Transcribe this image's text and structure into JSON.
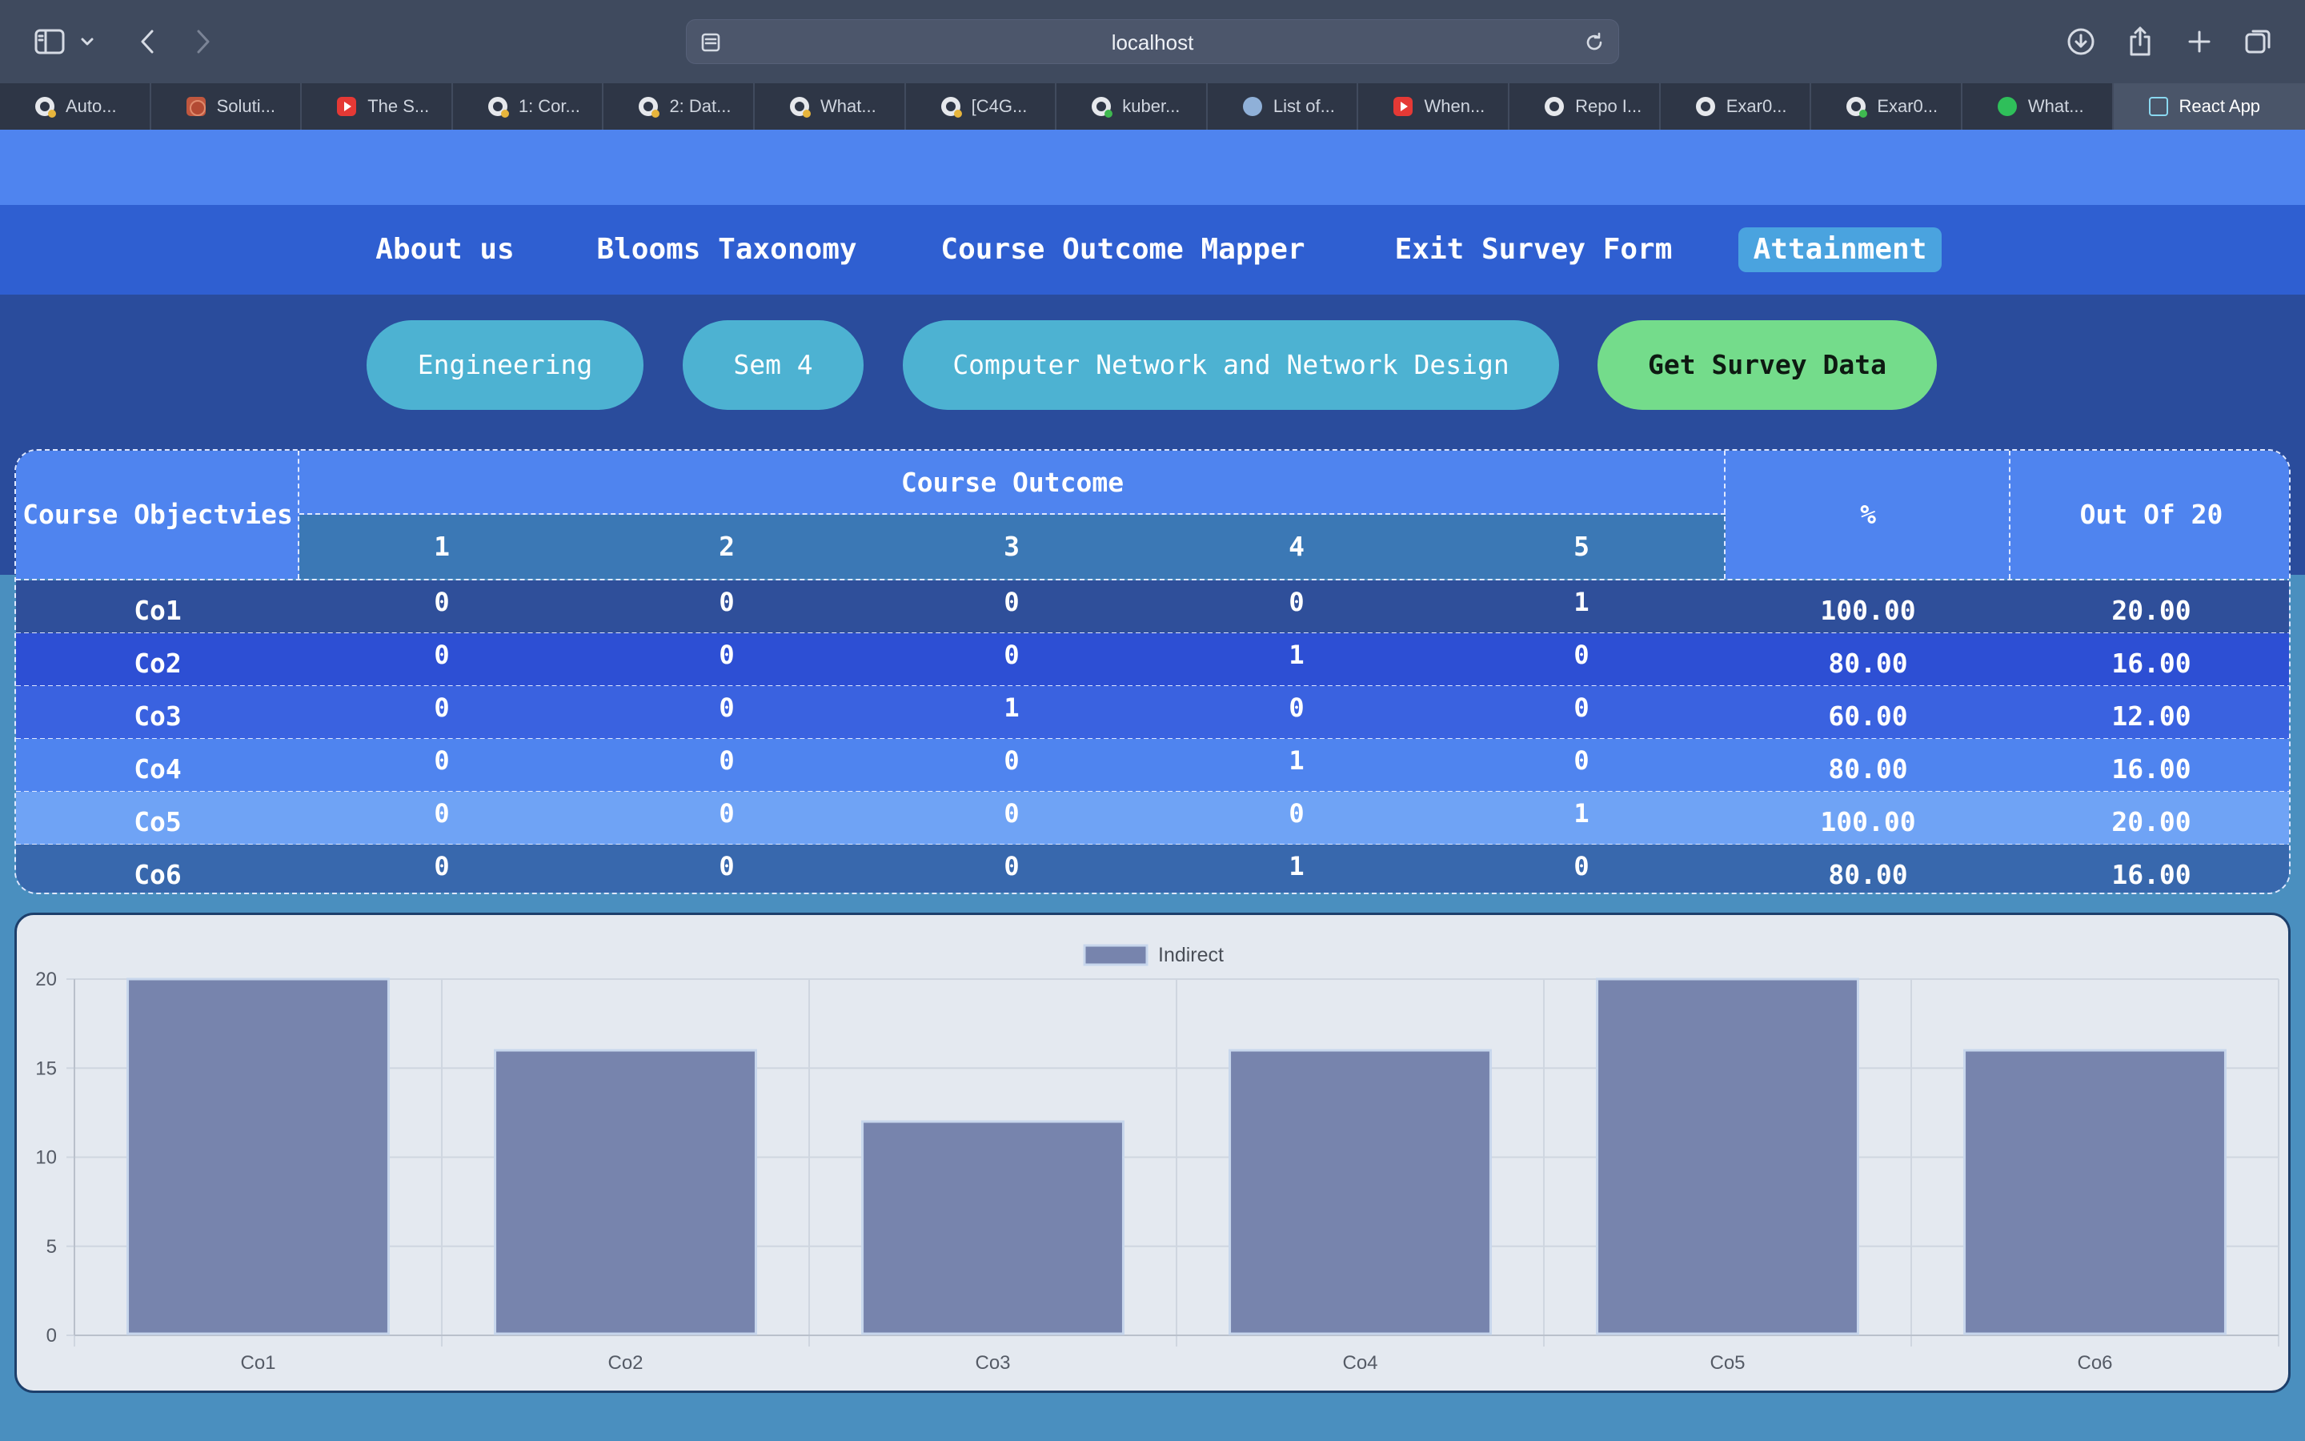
{
  "browser": {
    "url": "localhost",
    "tabs": [
      {
        "label": "Auto...",
        "icon": "github-icon"
      },
      {
        "label": "Soluti...",
        "icon": "solution-icon"
      },
      {
        "label": "The S...",
        "icon": "youtube-icon"
      },
      {
        "label": "1: Cor...",
        "icon": "github-icon"
      },
      {
        "label": "2: Dat...",
        "icon": "github-icon"
      },
      {
        "label": "What...",
        "icon": "github-icon"
      },
      {
        "label": "[C4G...",
        "icon": "github-icon"
      },
      {
        "label": "kuber...",
        "icon": "github-icon"
      },
      {
        "label": "List of...",
        "icon": "reddit-icon"
      },
      {
        "label": "When...",
        "icon": "youtube-icon"
      },
      {
        "label": "Repo I...",
        "icon": "github-icon"
      },
      {
        "label": "Exar0...",
        "icon": "github-icon"
      },
      {
        "label": "Exar0...",
        "icon": "github-icon"
      },
      {
        "label": "What...",
        "icon": "whatsapp-icon"
      },
      {
        "label": "React App",
        "icon": "react-icon"
      }
    ]
  },
  "nav": {
    "items": [
      {
        "label": "About us"
      },
      {
        "label": "Blooms Taxonomy"
      },
      {
        "label": "Course Outcome Mapper"
      },
      {
        "label": "Exit Survey Form"
      },
      {
        "label": "Attainment"
      }
    ],
    "active": "Attainment"
  },
  "filters": {
    "department": "Engineering",
    "semester": "Sem 4",
    "subject": "Computer Network and Network Design",
    "action": "Get Survey Data"
  },
  "table": {
    "header_objectives": "Course Objectvies",
    "header_outcome": "Course Outcome",
    "header_percent": "%",
    "header_outof": "Out Of 20",
    "outcome_cols": [
      "1",
      "2",
      "3",
      "4",
      "5"
    ],
    "rows": [
      {
        "co": "Co1",
        "values": [
          "0",
          "0",
          "0",
          "0",
          "1"
        ],
        "percent": "100.00",
        "outof": "20.00"
      },
      {
        "co": "Co2",
        "values": [
          "0",
          "0",
          "0",
          "1",
          "0"
        ],
        "percent": "80.00",
        "outof": "16.00"
      },
      {
        "co": "Co3",
        "values": [
          "0",
          "0",
          "1",
          "0",
          "0"
        ],
        "percent": "60.00",
        "outof": "12.00"
      },
      {
        "co": "Co4",
        "values": [
          "0",
          "0",
          "0",
          "1",
          "0"
        ],
        "percent": "80.00",
        "outof": "16.00"
      },
      {
        "co": "Co5",
        "values": [
          "0",
          "0",
          "0",
          "0",
          "1"
        ],
        "percent": "100.00",
        "outof": "20.00"
      },
      {
        "co": "Co6",
        "values": [
          "0",
          "0",
          "0",
          "1",
          "0"
        ],
        "percent": "80.00",
        "outof": "16.00"
      }
    ],
    "row_colors": [
      "#2f4f9a",
      "#2d4fd4",
      "#3a62e0",
      "#4f84ef",
      "#6fa3f5",
      "#3868ad"
    ]
  },
  "chart_data": {
    "type": "bar",
    "categories": [
      "Co1",
      "Co2",
      "Co3",
      "Co4",
      "Co5",
      "Co6"
    ],
    "series": [
      {
        "name": "Indirect",
        "values": [
          20,
          16,
          12,
          16,
          20,
          16
        ]
      }
    ],
    "ylim": [
      0,
      20
    ],
    "yticks": [
      0,
      5,
      10,
      15,
      20
    ],
    "legend": "top-center",
    "grid": true,
    "colors": {
      "bar": "#7784ad",
      "bar_border": "#c7d6ec"
    }
  }
}
